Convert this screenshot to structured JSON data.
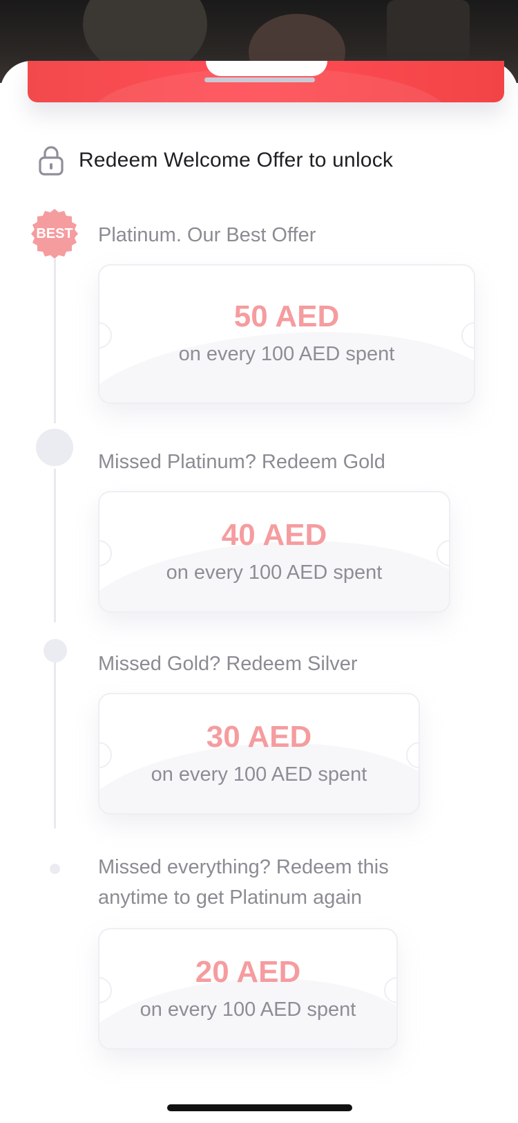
{
  "header": {
    "lock_message": "Redeem Welcome Offer to unlock"
  },
  "badge": {
    "label": "BEST",
    "color": "#f59c9f"
  },
  "tiers": [
    {
      "title": "Platinum. Our Best Offer",
      "amount": "50 AED",
      "subtitle": "on every 100 AED spent"
    },
    {
      "title": "Missed Platinum? Redeem Gold",
      "amount": "40 AED",
      "subtitle": "on every 100 AED spent"
    },
    {
      "title": "Missed Gold? Redeem Silver",
      "amount": "30 AED",
      "subtitle": "on every 100 AED spent"
    },
    {
      "title_line1": "Missed everything? Redeem this",
      "title_line2": "anytime to get Platinum again",
      "amount": "20 AED",
      "subtitle": "on every 100 AED spent"
    }
  ],
  "colors": {
    "banner_red": "#f24a4c",
    "amount_pink": "#f59c9f",
    "muted_text": "#8b8b93",
    "timeline": "#e8e9f0"
  }
}
